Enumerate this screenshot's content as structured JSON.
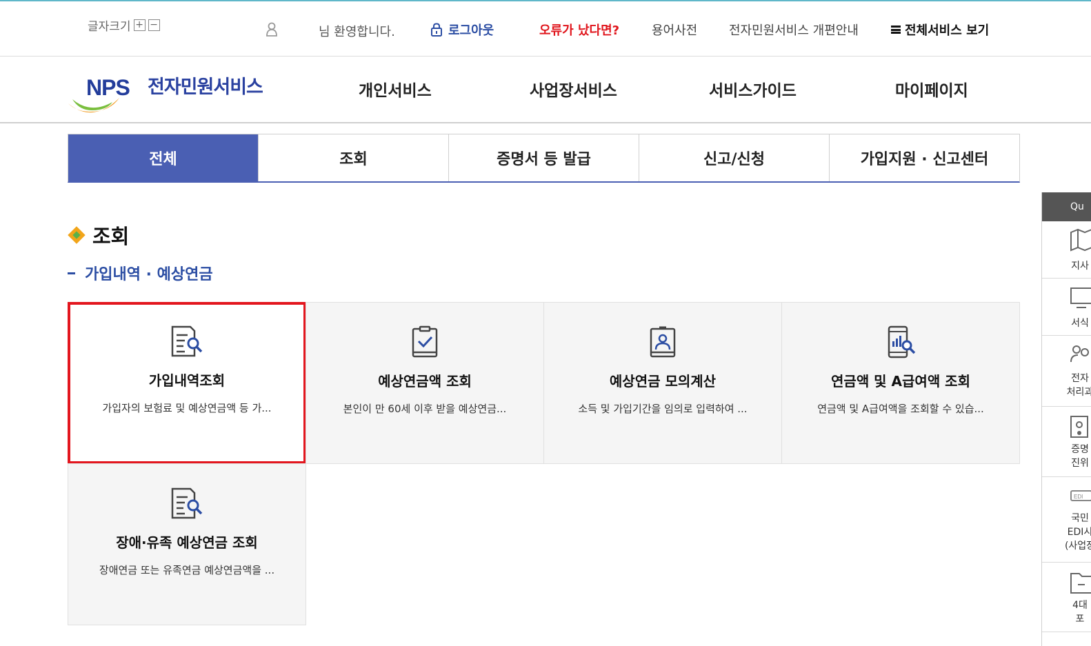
{
  "utility": {
    "font_size_label": "글자크기",
    "font_plus": "+",
    "font_minus": "−",
    "welcome": "님 환영합니다.",
    "logout": "로그아웃",
    "error_link": "오류가 났다면?",
    "dictionary": "용어사전",
    "renewal_notice": "전자민원서비스 개편안내",
    "all_services": "전체서비스 보기"
  },
  "logo": {
    "mark": "NPS",
    "name": "전자민원서비스"
  },
  "gnb": [
    "개인서비스",
    "사업장서비스",
    "서비스가이드",
    "마이페이지"
  ],
  "tabs": [
    {
      "label": "전체",
      "active": true
    },
    {
      "label": "조회",
      "active": false
    },
    {
      "label": "증명서 등 발급",
      "active": false
    },
    {
      "label": "신고/신청",
      "active": false
    },
    {
      "label": "가입지원 · 신고센터",
      "active": false
    }
  ],
  "section": {
    "title": "조회",
    "subtitle": "가입내역 · 예상연금"
  },
  "cards": [
    {
      "title": "가입내역조회",
      "desc": "가입자의 보험료 및 예상연금액 등 가...",
      "icon": "document-search-icon",
      "selected": true
    },
    {
      "title": "예상연금액 조회",
      "desc": "본인이 만 60세 이후 받을 예상연금...",
      "icon": "clipboard-check-icon",
      "selected": false
    },
    {
      "title": "예상연금 모의계산",
      "desc": "소득 및 가입기간을 임의로 입력하여 ...",
      "icon": "person-badge-icon",
      "selected": false
    },
    {
      "title": "연금액 및 A급여액 조회",
      "desc": "연금액 및 A급여액을 조회할 수 있습...",
      "icon": "mobile-chart-search-icon",
      "selected": false
    },
    {
      "title": "장애·유족 예상연금 조회",
      "desc": "장애연금 또는 유족연금 예상연금액을 ...",
      "icon": "document-search-icon",
      "selected": false
    }
  ],
  "quick_menu": {
    "header": "Qu",
    "items": [
      {
        "label": "지사",
        "icon": "map-icon"
      },
      {
        "label": "서식",
        "icon": "monitor-icon"
      },
      {
        "label": "전자\n처리과",
        "icon": "people-icon"
      },
      {
        "label": "증명\n진위",
        "icon": "certificate-icon"
      },
      {
        "label": "국민\nEDI시\n(사업장",
        "icon": "edi-icon"
      },
      {
        "label": "4대\n포",
        "icon": "folder-icon"
      }
    ]
  },
  "colors": {
    "accent_blue": "#4a5fb3",
    "link_blue": "#2b4da3",
    "error_red": "#e0151c",
    "selected_border": "#e3161e"
  }
}
